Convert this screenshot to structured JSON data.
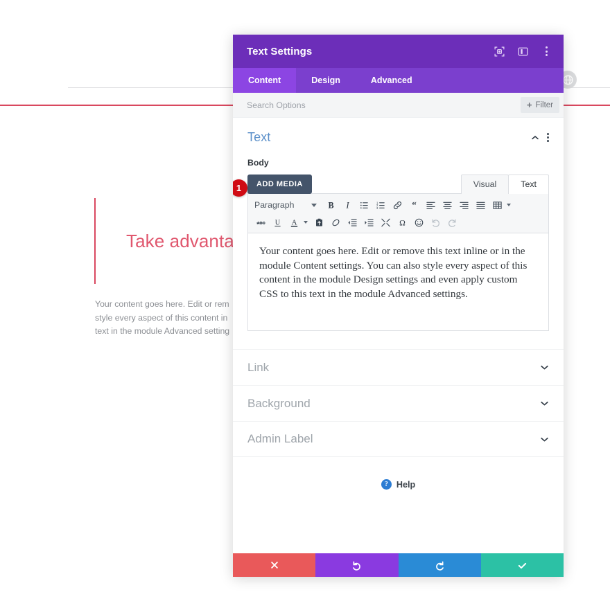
{
  "background": {
    "heading": "Take advantage",
    "body_lines": [
      "Your content goes here. Edit or rem",
      "style every aspect of this content in",
      "text in the module Advanced setting"
    ],
    "accent_color": "#d9485f",
    "heading_color": "#e0576e"
  },
  "modal": {
    "title": "Text Settings",
    "header_icons": [
      {
        "name": "focus-target-icon"
      },
      {
        "name": "layout-panel-icon"
      },
      {
        "name": "kebab-menu-icon"
      }
    ],
    "tabs": [
      {
        "label": "Content",
        "active": true
      },
      {
        "label": "Design",
        "active": false
      },
      {
        "label": "Advanced",
        "active": false
      }
    ],
    "search": {
      "value": "",
      "placeholder": "Search Options"
    },
    "filter_button": {
      "label": "Filter",
      "plus": "+"
    },
    "text_section": {
      "title": "Text",
      "field_label": "Body",
      "add_media_label": "ADD MEDIA",
      "editor_tabs": [
        {
          "label": "Visual",
          "active": false
        },
        {
          "label": "Text",
          "active": true
        }
      ],
      "format_select": "Paragraph",
      "toolbar_row1": [
        "bold-icon",
        "italic-icon",
        "bulleted-list-icon",
        "numbered-list-icon",
        "link-icon",
        "blockquote-icon",
        "align-left-icon",
        "align-center-icon",
        "align-right-icon",
        "align-justify-icon",
        "table-icon"
      ],
      "toolbar_row2": [
        "strikethrough-icon",
        "underline-icon",
        "text-color-icon",
        "paste-as-text-icon",
        "clear-formatting-icon",
        "outdent-icon",
        "indent-icon",
        "fullscreen-icon",
        "special-character-icon",
        "emoji-icon",
        "undo-icon",
        "redo-icon"
      ],
      "editor_content": "Your content goes here. Edit or remove this text inline or in the module Content settings. You can also style every aspect of this content in the module Design settings and even apply custom CSS to this text in the module Advanced settings.",
      "callout_badge": "1"
    },
    "sections": [
      {
        "label": "Link"
      },
      {
        "label": "Background"
      },
      {
        "label": "Admin Label"
      }
    ],
    "help": {
      "label": "Help",
      "icon_glyph": "?"
    },
    "footer_buttons": [
      {
        "name": "cancel-button",
        "color": "#e9595a",
        "icon": "close-x-icon"
      },
      {
        "name": "undo-button",
        "color": "#8a3ae0",
        "icon": "undo-arrow-icon"
      },
      {
        "name": "redo-button",
        "color": "#2a8bd6",
        "icon": "redo-arrow-icon"
      },
      {
        "name": "save-button",
        "color": "#2cc1a5",
        "icon": "checkmark-icon"
      }
    ],
    "colors": {
      "header_purple": "#6c2eb9",
      "tabbar_purple": "#7b3fce",
      "tab_active_purple": "#8c45e3",
      "section_title_blue": "#5b8fc9"
    }
  }
}
